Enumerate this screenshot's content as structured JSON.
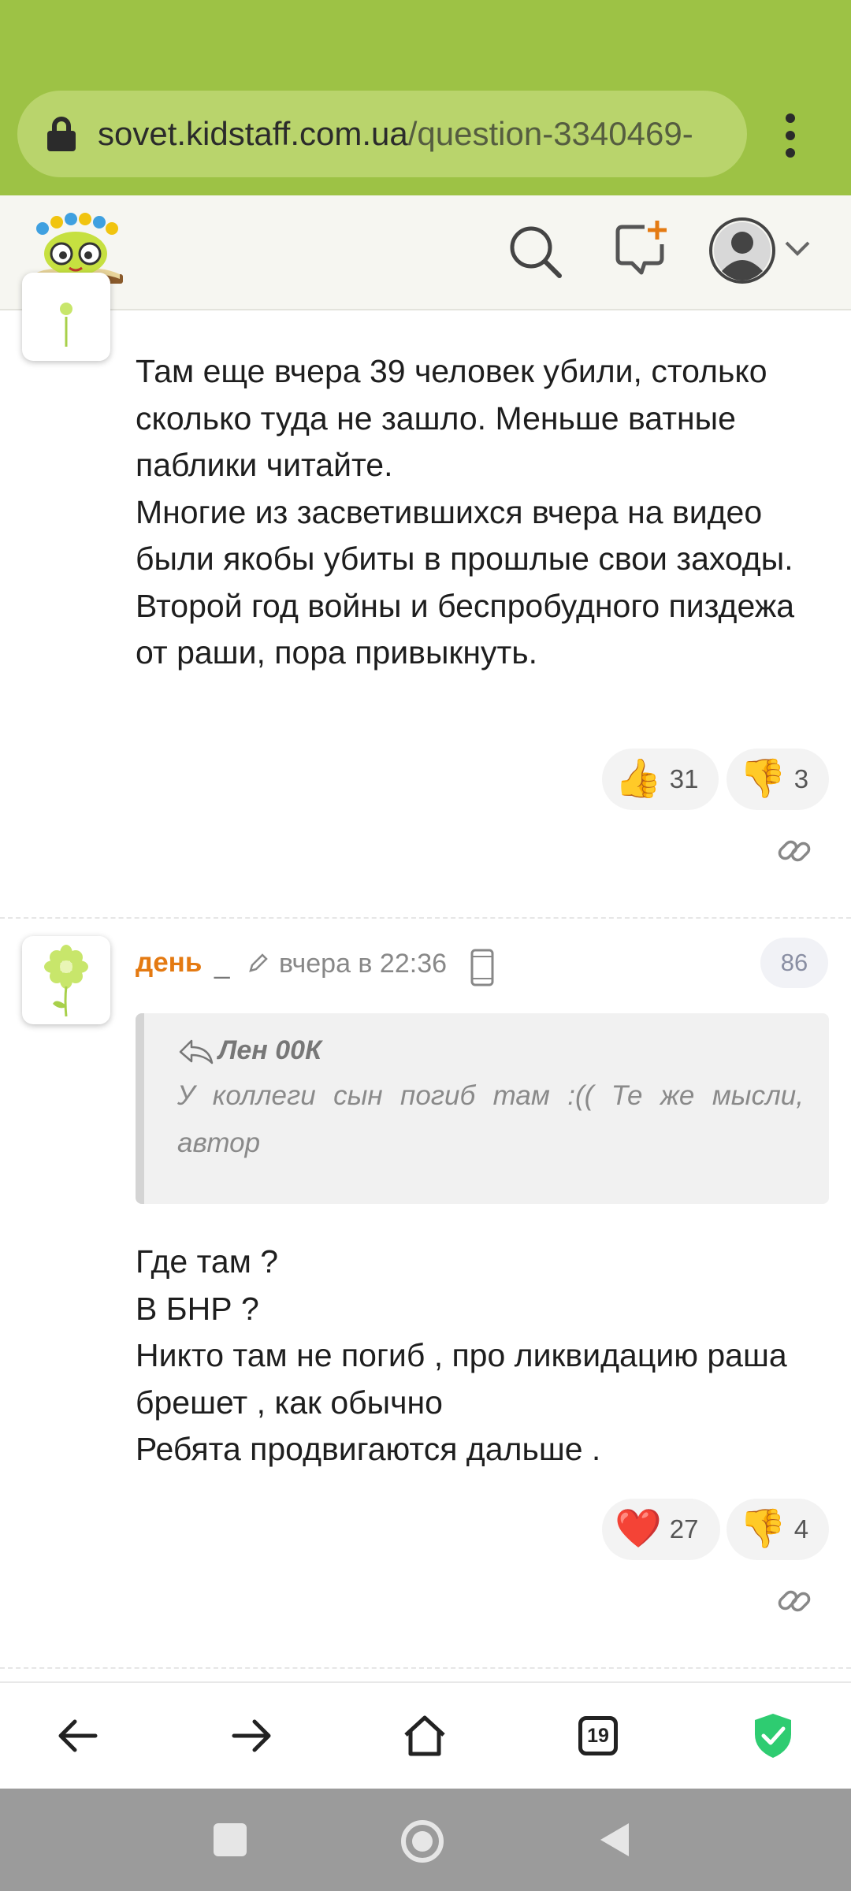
{
  "browser": {
    "url_domain": "sovet.kidstaff.com.ua",
    "url_path": "/question-3340469-",
    "tabs_count": "19"
  },
  "comments": [
    {
      "body": "Там еще вчера 39 человек убили, столько сколько туда не зашло. Меньше ватные паблики читайте.\nМногие из засветившихся вчера на видео были якобы убиты в прошлые свои заходы. Второй год войны и беспробудного пиздежа от раши, пора привыкнуть.",
      "likes": "31",
      "dislikes": "3"
    },
    {
      "author": "день",
      "underscore": "_",
      "time": "вчера в 22:36",
      "post_number": "86",
      "quote_author": "Лен 00К",
      "quote_text": "У коллеги сын погиб там :(( Те же мысли, автор",
      "body": "Где там ?\nВ БНР ?\nНикто там не погиб , про ликвидацию раша брешет , как обычно\nРебята продвигаются дальше .",
      "hearts": "27",
      "dislikes": "4"
    }
  ],
  "colors": {
    "browser_bar": "#9dc245",
    "author_orange": "#e47a12",
    "shield_green": "#2ecc71"
  },
  "icons": [
    "lock-icon",
    "menu-icon",
    "search-icon",
    "add-comment-icon",
    "user-avatar-icon",
    "chevron-down-icon",
    "thumbs-up-icon",
    "thumbs-down-icon",
    "heart-icon",
    "link-icon",
    "pencil-icon",
    "mobile-device-icon",
    "reply-icon",
    "back-arrow-icon",
    "forward-arrow-icon",
    "home-icon",
    "tabs-icon",
    "shield-check-icon"
  ]
}
